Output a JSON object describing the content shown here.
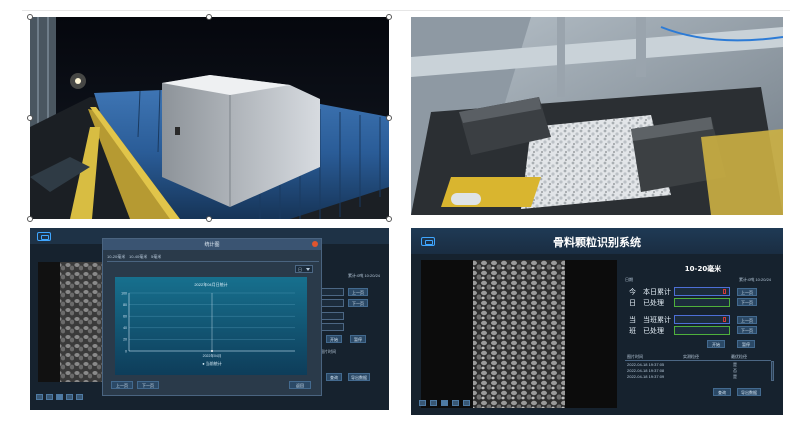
{
  "right_app": {
    "title": "骨料颗粒识别系统",
    "subtitle": "10-20毫米",
    "info_label": "日期",
    "info_value": "累计:0吨 10:20/24",
    "row_today": "本日累计",
    "row_today_side": "今",
    "row_today_done": "已处理",
    "row_today_done_side": "日",
    "row_shift": "当班累计",
    "row_shift_side": "当",
    "row_shift_done": "已处理",
    "row_shift_done_side": "班",
    "btn_prev": "上一页",
    "btn_next": "下一页",
    "btn_start": "开始",
    "btn_stop": "暂停",
    "table_headers": [
      "图片时间",
      "实测粒径",
      "最优粒径"
    ],
    "table_rows": [
      [
        "2022-04-18 19:37:05",
        "",
        "是"
      ],
      [
        "2022-04-18 19:37:08",
        "",
        "否"
      ],
      [
        "2022-04-18 19:37:09",
        "",
        "是"
      ]
    ],
    "btn_query": "查询",
    "btn_export": "导出数据"
  },
  "left_app": {
    "dialog_title": "统计图",
    "tabs": [
      "10-20毫米",
      "10-40毫米",
      "5毫米"
    ],
    "filter_label": "日",
    "chart_header": "2022年04月日统计",
    "info_value": "累计:0吨 10:20/24",
    "btn_prev": "上一页",
    "btn_next": "下一页",
    "btn_close": "返回",
    "side_btn_1": "上一页",
    "side_btn_2": "下一页",
    "side_btn_3": "开始",
    "side_btn_4": "暂停",
    "side_btn_5": "查询",
    "side_btn_6": "导出数据",
    "side_label": "图片时间"
  },
  "chart_data": {
    "type": "line",
    "title": "",
    "xlabel": "",
    "ylabel": "",
    "categories": [
      "2022年04月"
    ],
    "ylim": [
      0,
      100
    ],
    "yticks": [
      "100",
      "80",
      "60",
      "40",
      "20",
      "0"
    ],
    "legend": "● 当前统计",
    "series": [
      {
        "name": "",
        "values": [
          0
        ]
      }
    ]
  },
  "colors": {
    "accent": "#3fa6ff",
    "screen_bg": "#16222e",
    "header_bg": "#1e3246",
    "field_blue": "#4d6fd6",
    "field_green": "#4fb03c",
    "marker_red": "#d23a3a"
  }
}
